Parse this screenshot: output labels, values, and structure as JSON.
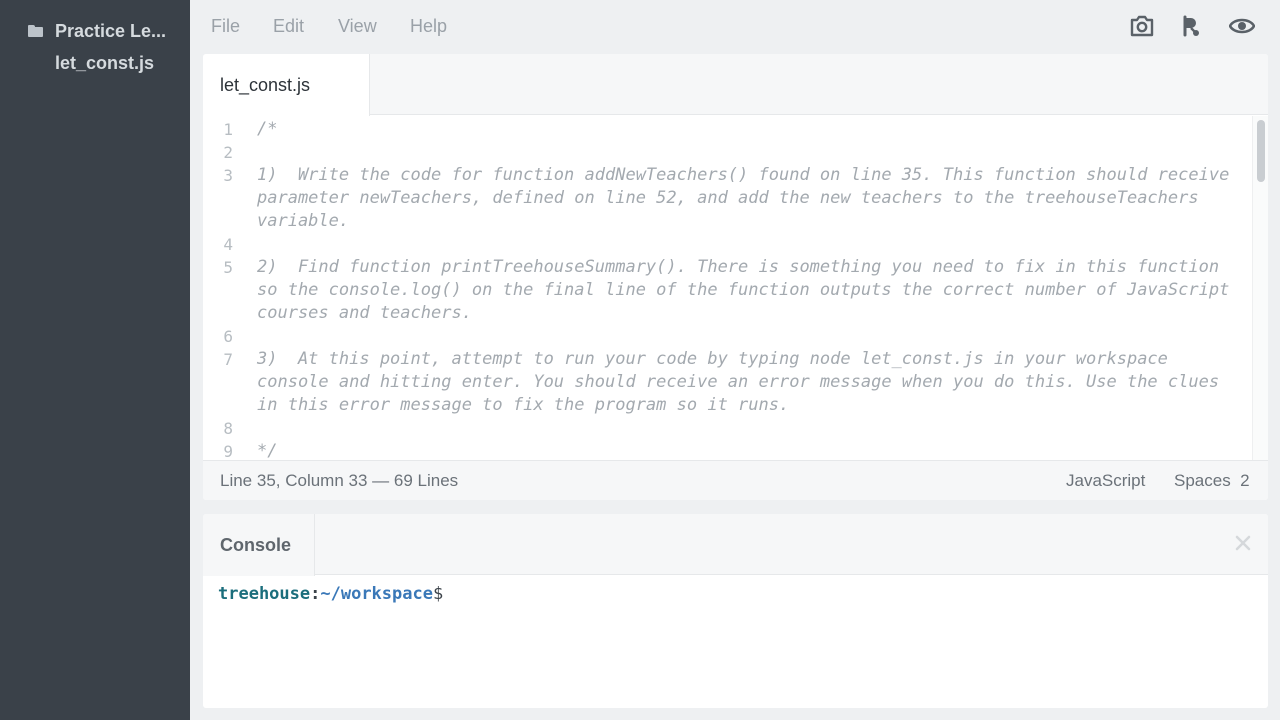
{
  "sidebar": {
    "folder_name": "Practice Le...",
    "files": [
      "let_const.js"
    ]
  },
  "menubar": {
    "items": [
      "File",
      "Edit",
      "View",
      "Help"
    ],
    "tools": [
      "camera-icon",
      "share-icon",
      "eye-icon"
    ]
  },
  "editor": {
    "tab_label": "let_const.js",
    "lines": [
      {
        "n": "1",
        "text": "/*"
      },
      {
        "n": "2",
        "text": ""
      },
      {
        "n": "3",
        "text": "1)  Write the code for function addNewTeachers() found on line 35. This function should receive parameter newTeachers, defined on line 52, and add the new teachers to the treehouseTeachers variable."
      },
      {
        "n": "4",
        "text": ""
      },
      {
        "n": "5",
        "text": "2)  Find function printTreehouseSummary(). There is something you need to fix in this function so the console.log() on the final line of the function outputs the correct number of JavaScript courses and teachers."
      },
      {
        "n": "6",
        "text": ""
      },
      {
        "n": "7",
        "text": "3)  At this point, attempt to run your code by typing node let_const.js in your workspace console and hitting enter. You should receive an error message when you do this. Use the clues in this error message to fix the program so it runs."
      },
      {
        "n": "8",
        "text": ""
      },
      {
        "n": "9",
        "text": "*/"
      }
    ]
  },
  "statusbar": {
    "position": "Line 35, Column 33 — 69 Lines",
    "language": "JavaScript",
    "spaces": "Spaces  2"
  },
  "console": {
    "tab_label": "Console",
    "prompt_user": "treehouse",
    "prompt_sep": ":",
    "prompt_path": "~/workspace",
    "prompt_symbol": "$"
  }
}
